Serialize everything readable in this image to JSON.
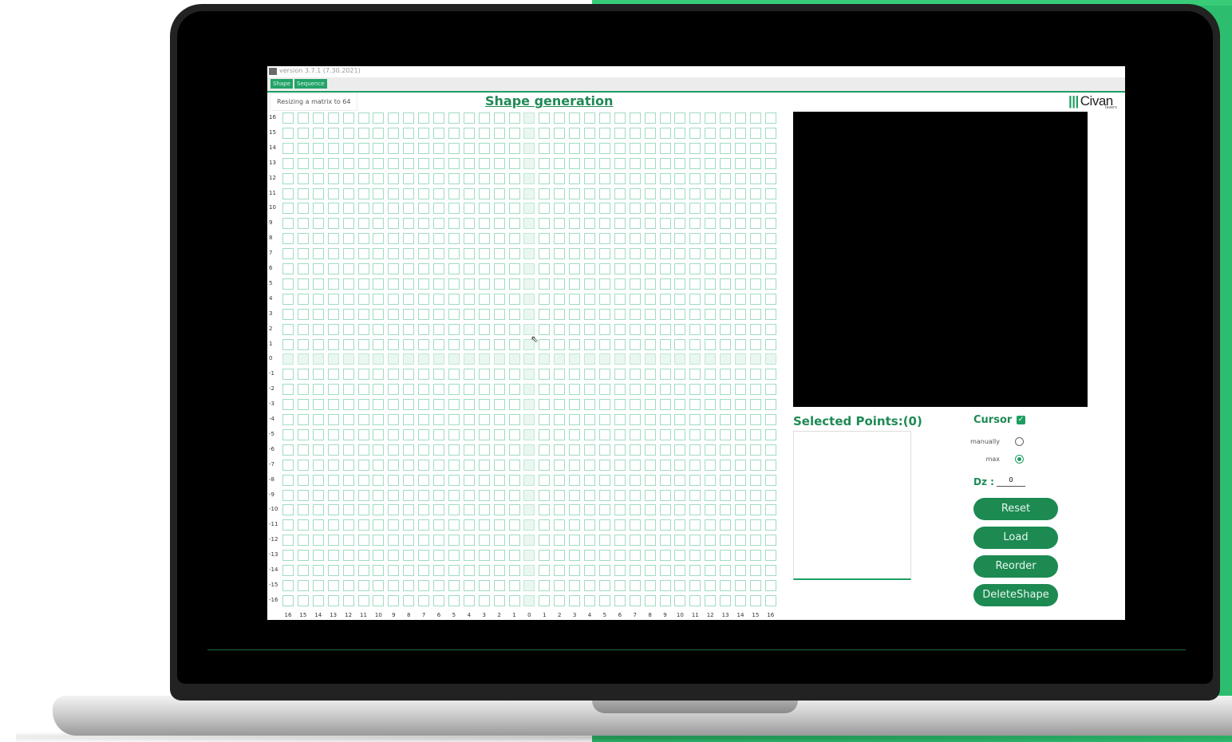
{
  "window": {
    "title": "version 3.7.1 (7.30.2021)"
  },
  "menu": {
    "tabs": [
      {
        "label": "Shape"
      },
      {
        "label": "Sequence"
      }
    ]
  },
  "status_field": {
    "value": "Resizing a matrix to 64"
  },
  "page_title": "Shape generation",
  "logo": {
    "mark": "|||",
    "name": "Civan",
    "sub": "lasers"
  },
  "grid": {
    "y_labels": [
      "16",
      "15",
      "14",
      "13",
      "12",
      "11",
      "10",
      "9",
      "8",
      "7",
      "6",
      "5",
      "4",
      "3",
      "2",
      "1",
      "0",
      "-1",
      "-2",
      "-3",
      "-4",
      "-5",
      "-6",
      "-7",
      "-8",
      "-9",
      "-10",
      "-11",
      "-12",
      "-13",
      "-14",
      "-15",
      "-16"
    ],
    "x_labels": [
      "16",
      "15",
      "14",
      "13",
      "12",
      "11",
      "10",
      "9",
      "8",
      "7",
      "6",
      "5",
      "4",
      "3",
      "2",
      "1",
      "0",
      "1",
      "2",
      "3",
      "4",
      "5",
      "6",
      "7",
      "8",
      "9",
      "10",
      "11",
      "12",
      "13",
      "14",
      "15",
      "16"
    ]
  },
  "selected_points": {
    "title": "Selected Points:(0)"
  },
  "cursor": {
    "label": "Cursor",
    "checked": true,
    "options": [
      {
        "label": "manually",
        "selected": false
      },
      {
        "label": "max",
        "selected": true
      }
    ]
  },
  "dz": {
    "label": "Dz :",
    "value": "0"
  },
  "buttons": {
    "reset": "Reset",
    "load": "Load",
    "reorder": "Reorder",
    "delete_shape": "DeleteShape"
  },
  "colors": {
    "accent": "#1d8a52",
    "grid_line": "#9fdcc1",
    "background_green": "#2dbd6e"
  }
}
